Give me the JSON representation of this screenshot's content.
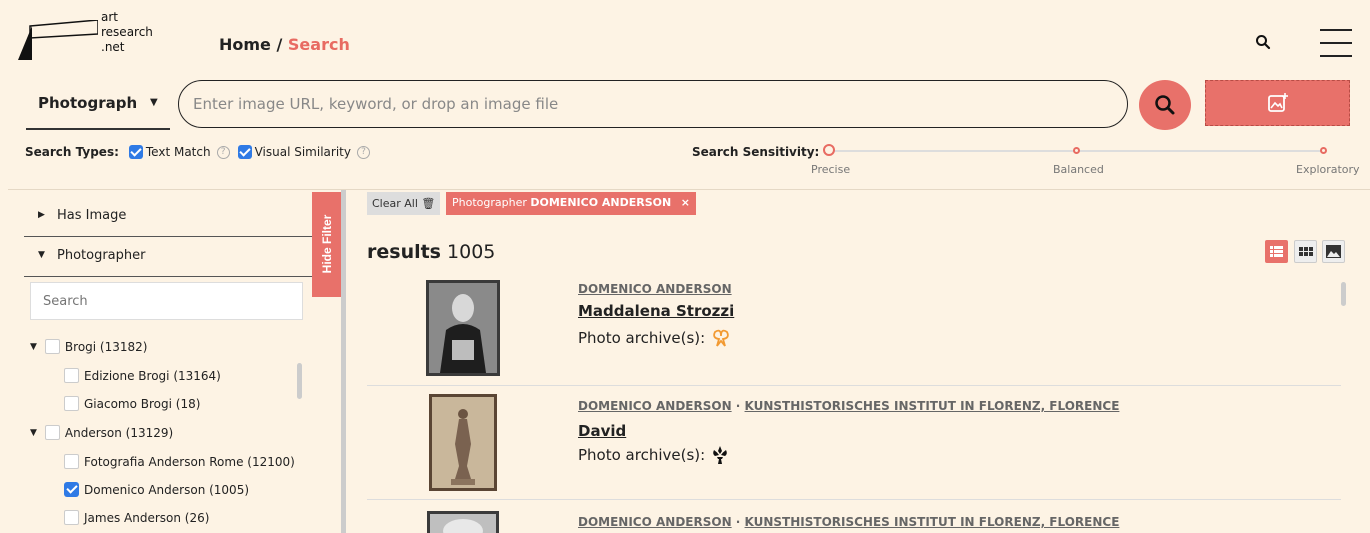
{
  "header": {
    "logo_lines": [
      "art",
      "research",
      ".net"
    ],
    "breadcrumb_home": "Home",
    "breadcrumb_sep": " / ",
    "breadcrumb_current": "Search"
  },
  "search": {
    "type_label": "Photograph",
    "placeholder": "Enter image URL, keyword, or drop an image file"
  },
  "search_types": {
    "label": "Search Types:",
    "text_match": "Text Match",
    "visual_similarity": "Visual Similarity"
  },
  "sensitivity": {
    "label": "Search Sensitivity:",
    "precise": "Precise",
    "balanced": "Balanced",
    "exploratory": "Exploratory"
  },
  "sidebar": {
    "hide_filter": "Hide Filter",
    "facet_has_image": "Has Image",
    "facet_photographer": "Photographer",
    "facet_search_placeholder": "Search",
    "tree": [
      {
        "label": "Brogi (13182)"
      },
      {
        "label": "Edizione Brogi (13164)"
      },
      {
        "label": "Giacomo Brogi (18)"
      },
      {
        "label": "Anderson (13129)"
      },
      {
        "label": "Fotografia Anderson Rome (12100)"
      },
      {
        "label": "Domenico Anderson (1005)"
      },
      {
        "label": "James Anderson (26)"
      }
    ]
  },
  "filters": {
    "clear_all": "Clear All",
    "chip_label": "Photographer",
    "chip_value": "DOMENICO ANDERSON",
    "chip_close": "×"
  },
  "results": {
    "heading": "results",
    "count": "1005",
    "archive_label": "Photo archive(s):",
    "items": [
      {
        "photographer": "DOMENICO ANDERSON",
        "institution": "",
        "title": "Maddalena Strozzi"
      },
      {
        "photographer": "DOMENICO ANDERSON",
        "institution": "KUNSTHISTORISCHES INSTITUT IN FLORENZ, FLORENCE",
        "title": "David"
      },
      {
        "photographer": "DOMENICO ANDERSON",
        "institution": "KUNSTHISTORISCHES INSTITUT IN FLORENZ, FLORENCE",
        "title": ""
      }
    ]
  },
  "colors": {
    "accent": "#e8716a",
    "background": "#fdf3e4",
    "checkbox": "#2f7ae5"
  }
}
